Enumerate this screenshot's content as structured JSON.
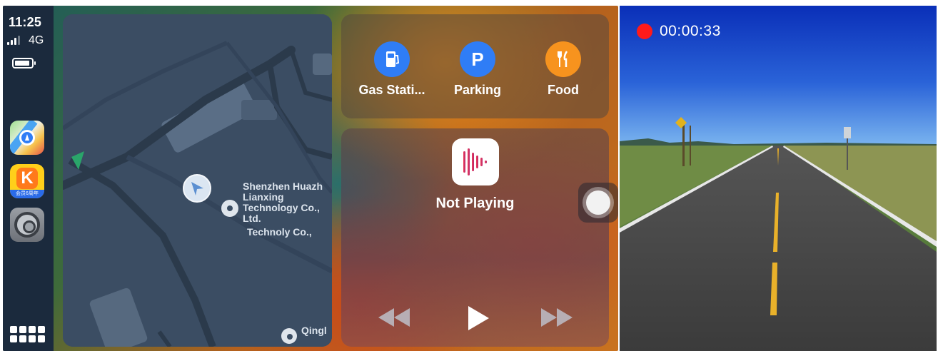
{
  "status_bar": {
    "time": "11:25",
    "network": "4G"
  },
  "dock": {
    "apps": [
      {
        "name": "Maps",
        "icon": "maps-icon"
      },
      {
        "name": "Music",
        "icon": "kuwo-music-icon",
        "badge_text": "会员6周年"
      },
      {
        "name": "Settings",
        "icon": "settings-gear-icon"
      }
    ],
    "app_grid_icon": "app-grid-icon"
  },
  "map": {
    "poi_labels": {
      "main": "Shenzhen Huazh\nLianxing\nTechnology Co.,\nLtd.",
      "secondary": "Technoly Co.,",
      "bottom": "Qingl"
    },
    "icons": [
      "navigation-arrow-icon",
      "poi-marker-icon"
    ]
  },
  "poi_shortcuts": [
    {
      "label": "Gas Stati...",
      "icon": "fuel-pump-icon",
      "color": "#2f7df6"
    },
    {
      "label": "Parking",
      "icon": "parking-icon",
      "glyph": "P",
      "color": "#2f7df6"
    },
    {
      "label": "Food",
      "icon": "fork-knife-icon",
      "color": "#f7931e"
    }
  ],
  "now_playing": {
    "status": "Not Playing",
    "icon": "music-waveform-icon",
    "controls": [
      "rewind-icon",
      "play-icon",
      "fast-forward-icon"
    ]
  },
  "dashcam": {
    "recording_time": "00:00:33",
    "rec_color": "#ff1a1a"
  }
}
